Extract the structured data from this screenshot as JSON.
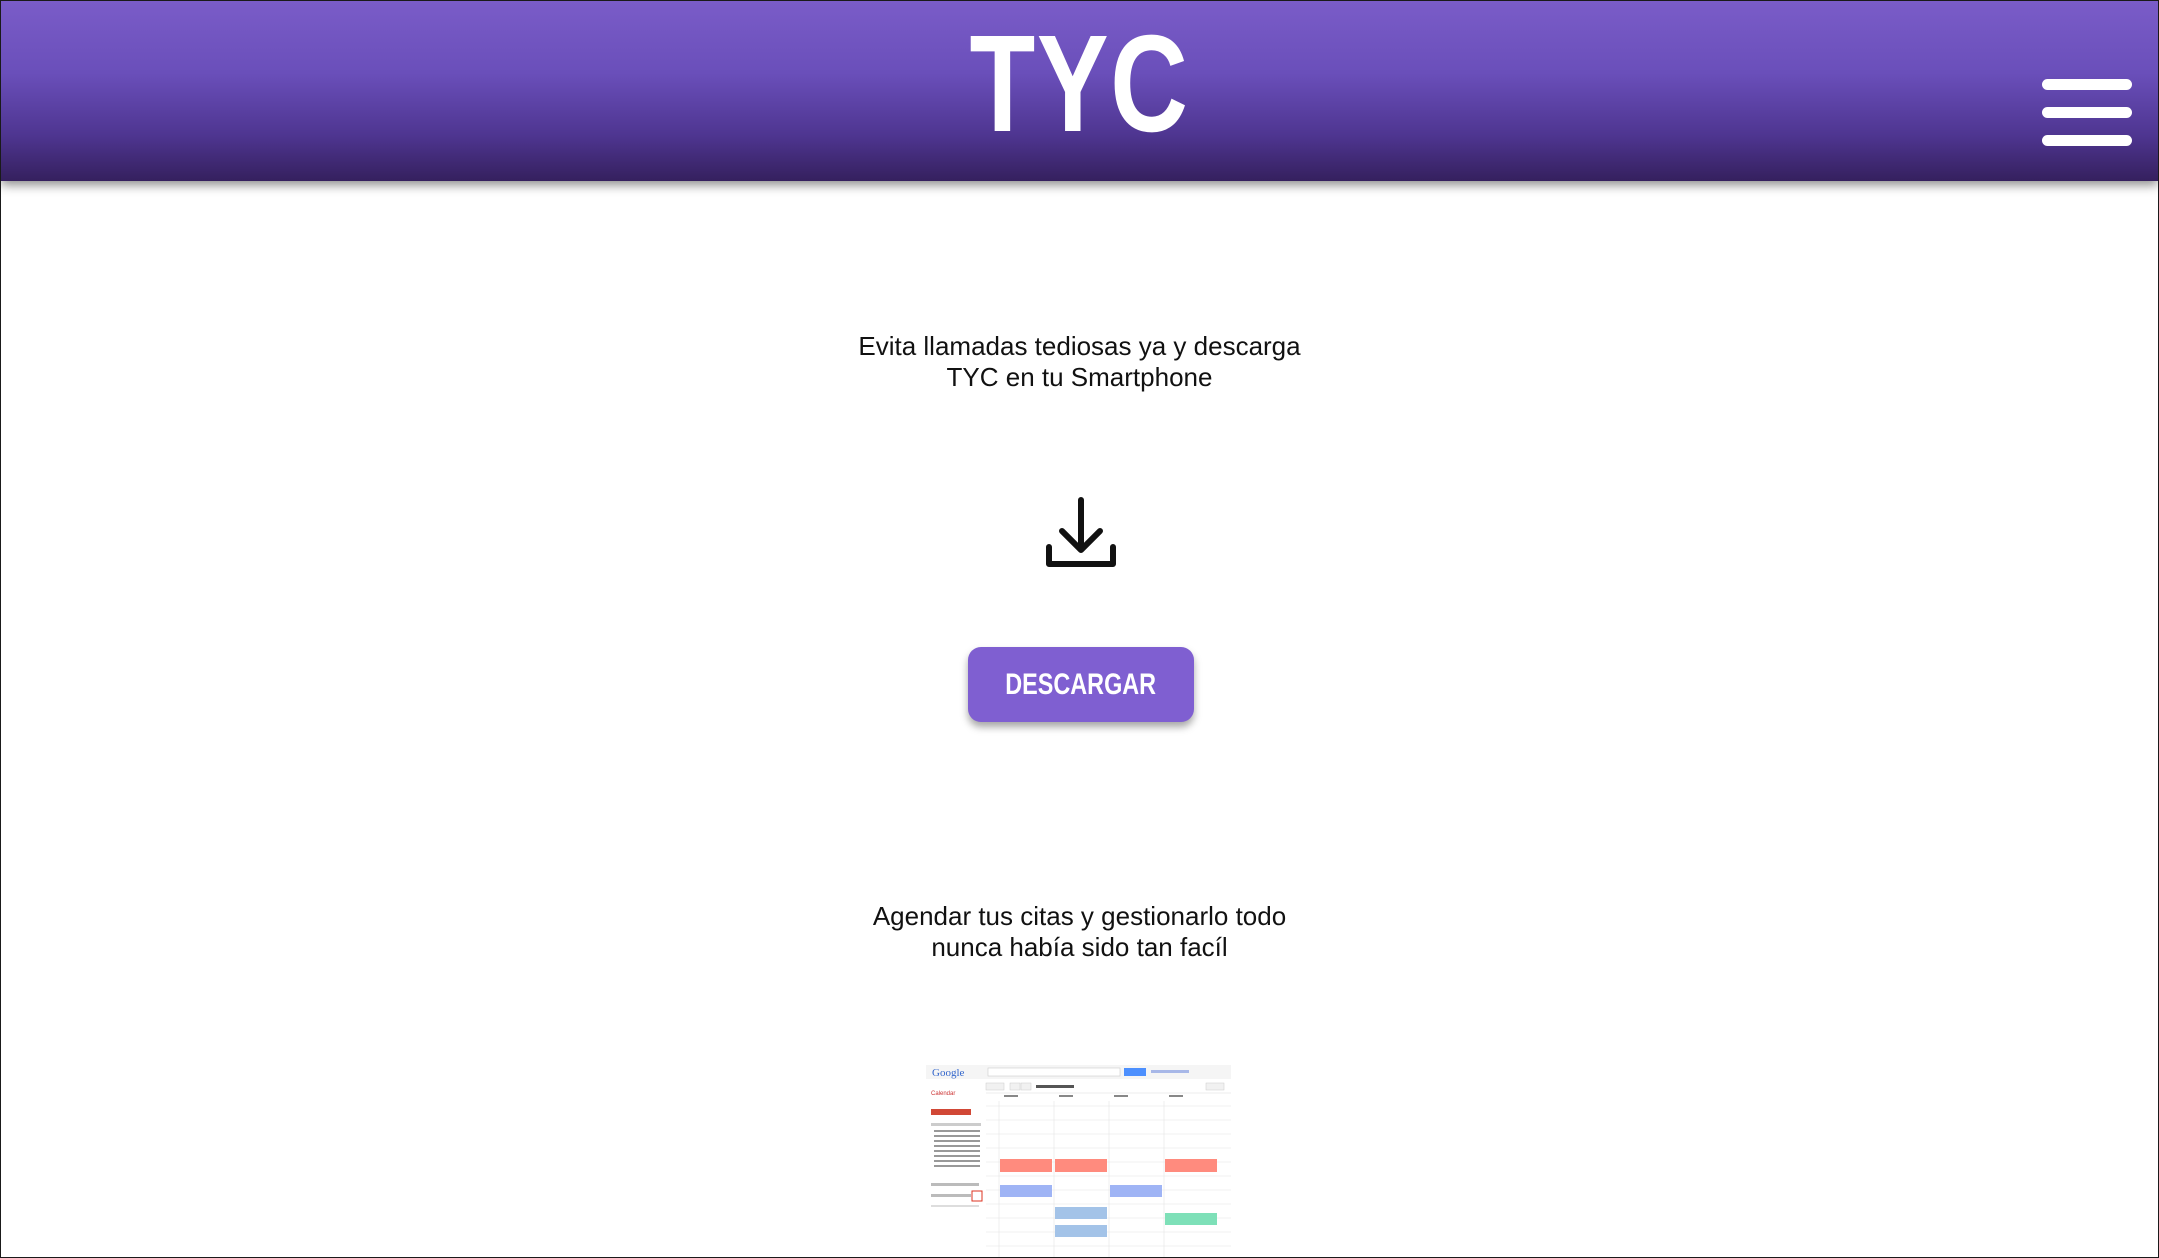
{
  "header": {
    "logo": "TYC",
    "menu_icon": "hamburger-menu-icon",
    "gradient_top": "#7a5cc8",
    "gradient_bottom": "#35205e"
  },
  "intro": {
    "line1": "Evita llamadas tediosas ya y descarga",
    "line2": "TYC en tu Smartphone"
  },
  "download": {
    "icon": "download-icon",
    "button_label": "DESCARGAR",
    "button_color": "#7f5fd1"
  },
  "agenda": {
    "line1": "Agendar tus citas y gestionarlo todo",
    "line2": "nunca había sido tan facíl"
  },
  "calendar_preview": {
    "brand": "Google",
    "app": "Calendar"
  }
}
